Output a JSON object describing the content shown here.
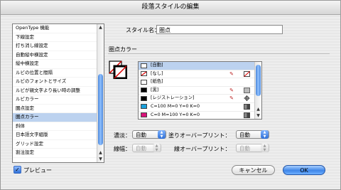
{
  "window": {
    "title": "段落スタイルの編集"
  },
  "sidebar": {
    "items": [
      {
        "label": "OpenType 機能",
        "selected": false
      },
      {
        "label": "下線設定",
        "selected": false
      },
      {
        "label": "打ち消し線設定",
        "selected": false
      },
      {
        "label": "自動縦中横設定",
        "selected": false
      },
      {
        "label": "縦中横設定",
        "selected": false
      },
      {
        "label": "ルビの位置と間隔",
        "selected": false
      },
      {
        "label": "ルビのフォントとサイズ",
        "selected": false
      },
      {
        "label": "ルビが親文字より長い時の調整",
        "selected": false
      },
      {
        "label": "ルビカラー",
        "selected": false
      },
      {
        "label": "圏点設定",
        "selected": false
      },
      {
        "label": "圏点カラー",
        "selected": true
      },
      {
        "label": "斜体",
        "selected": false
      },
      {
        "label": "日本語文字組版",
        "selected": false
      },
      {
        "label": "グリッド設定",
        "selected": false
      },
      {
        "label": "割注設定",
        "selected": false
      }
    ]
  },
  "style_name": {
    "label": "スタイル名：",
    "value": "圏点"
  },
  "section": {
    "title": "圏点カラー"
  },
  "swatches": [
    {
      "name": "[自動]",
      "color": "#ffffff",
      "selected": true,
      "icon1": "",
      "icon2": ""
    },
    {
      "name": "[なし]",
      "color": "none",
      "selected": false,
      "icon1": "no-edit-icon",
      "icon2": "none-swatch-icon"
    },
    {
      "name": "[紙色]",
      "color": "#ffffff",
      "selected": false,
      "icon1": "",
      "icon2": ""
    },
    {
      "name": "[黒]",
      "color": "#000000",
      "selected": false,
      "icon1": "no-edit-icon",
      "icon2": "process-color-icon"
    },
    {
      "name": "[レジストレーション]",
      "color": "#000000",
      "selected": false,
      "icon1": "no-edit-icon",
      "icon2": "registration-icon"
    },
    {
      "name": "C=100 M=0 Y=0 K=0",
      "color": "#1aa0dc",
      "selected": false,
      "icon1": "",
      "icon2": "cmyk-icon"
    },
    {
      "name": "C=0 M=100 Y=0 K=0",
      "color": "#d9137a",
      "selected": false,
      "icon1": "",
      "icon2": "cmyk-icon"
    }
  ],
  "tint": {
    "label": "濃淡：",
    "value": "自動"
  },
  "overprint_fill": {
    "label": "塗りオーバープリント：",
    "value": "自動"
  },
  "weight": {
    "label": "線幅：",
    "value": "自動"
  },
  "overprint_stroke": {
    "label": "線オーバープリント：",
    "value": "自動"
  },
  "preview": {
    "label": "プレビュー",
    "checked": true
  },
  "buttons": {
    "cancel": "キャンセル",
    "ok": "OK"
  }
}
